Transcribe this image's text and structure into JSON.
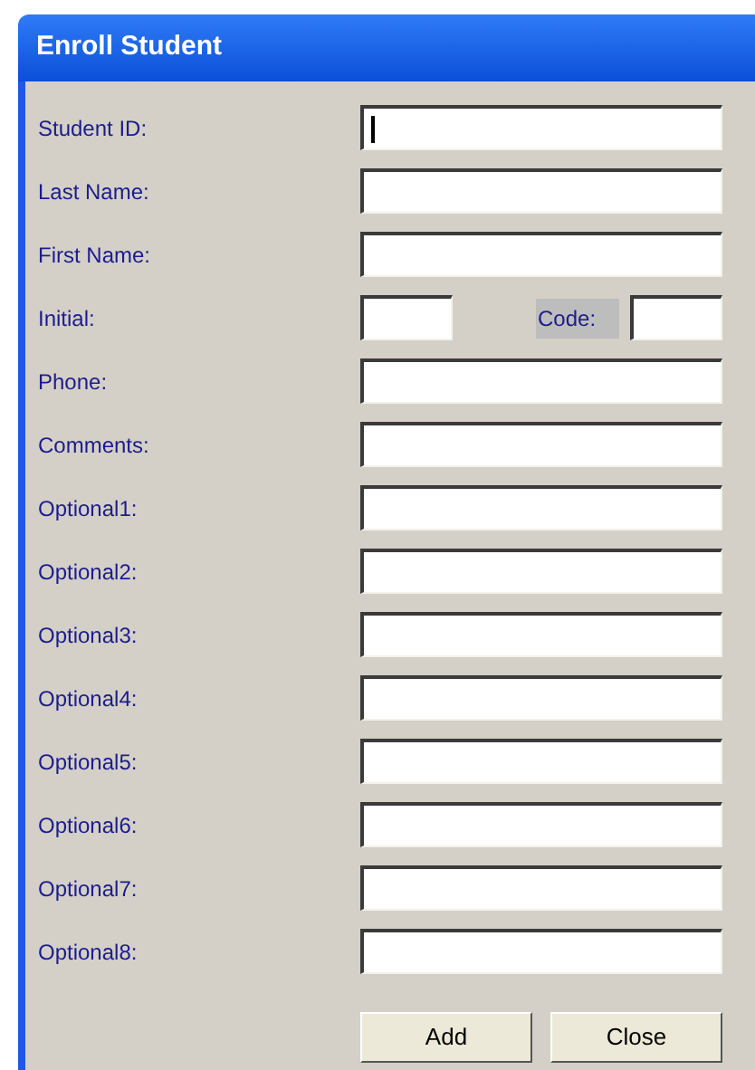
{
  "window": {
    "title": "Enroll Student"
  },
  "rows": [
    {
      "kind": "text",
      "label": "Student ID:",
      "focused": true
    },
    {
      "kind": "text",
      "label": "Last Name:",
      "focused": false
    },
    {
      "kind": "text",
      "label": "First Name:",
      "focused": false
    },
    {
      "kind": "pair",
      "label": "Initial:",
      "second_label": "Code:",
      "focused": false
    },
    {
      "kind": "text",
      "label": "Phone:",
      "focused": false
    },
    {
      "kind": "text",
      "label": "Comments:",
      "focused": false
    },
    {
      "kind": "text",
      "label": "Optional1:",
      "focused": false
    },
    {
      "kind": "text",
      "label": "Optional2:",
      "focused": false
    },
    {
      "kind": "text",
      "label": "Optional3:",
      "focused": false
    },
    {
      "kind": "text",
      "label": "Optional4:",
      "focused": false
    },
    {
      "kind": "text",
      "label": "Optional5:",
      "focused": false
    },
    {
      "kind": "text",
      "label": "Optional6:",
      "focused": false
    },
    {
      "kind": "text",
      "label": "Optional7:",
      "focused": false
    },
    {
      "kind": "text",
      "label": "Optional8:",
      "focused": false
    }
  ],
  "buttons": [
    "Add",
    "Close"
  ]
}
